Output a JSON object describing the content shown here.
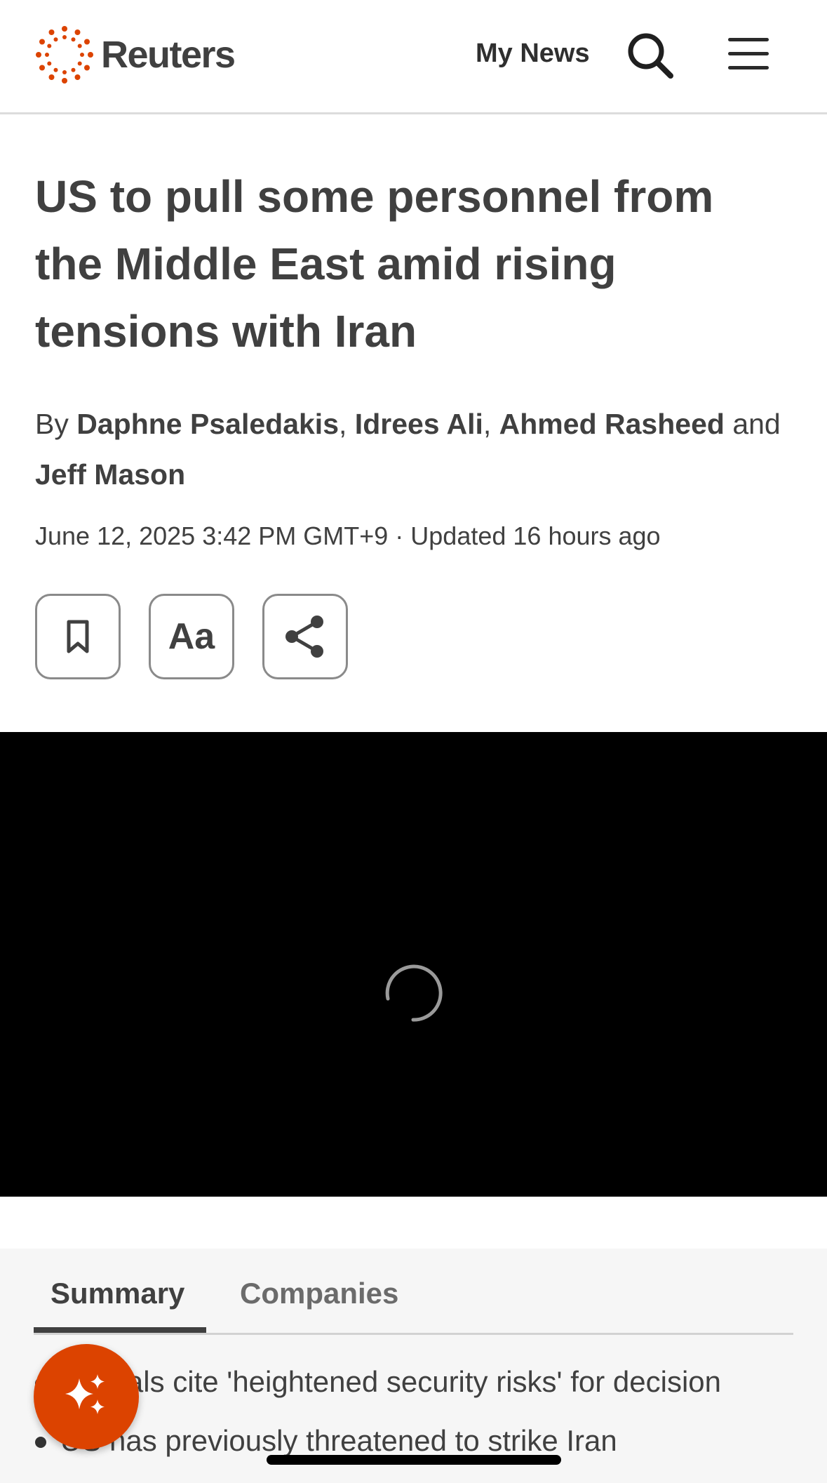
{
  "header": {
    "brand": "Reuters",
    "my_news": "My News",
    "brand_color": "#dc4300"
  },
  "article": {
    "headline": "US to pull some personnel from the Middle East amid rising tensions with Iran",
    "byline": {
      "prefix": "By",
      "authors": [
        "Daphne Psaledakis",
        "Idrees Ali",
        "Ahmed Rasheed",
        "Jeff Mason"
      ],
      "sep1": ", ",
      "sep2": ", ",
      "conjunction": "and"
    },
    "dateline": "June 12, 2025 3:42 PM GMT+9 · Updated 16 hours ago"
  },
  "actions": {
    "bookmark_icon": "bookmark-icon",
    "text_size_label": "Aa",
    "share_icon": "share-icon"
  },
  "video": {
    "state": "loading",
    "icon": "loading-spinner"
  },
  "summary": {
    "tabs": [
      {
        "label": "Summary",
        "active": true
      },
      {
        "label": "Companies",
        "active": false
      }
    ],
    "bullets": [
      "Officials cite 'heightened security risks' for decision",
      "US has previously threatened to strike Iran"
    ]
  },
  "fab": {
    "icon": "sparkles-icon",
    "color": "#dc4300"
  }
}
